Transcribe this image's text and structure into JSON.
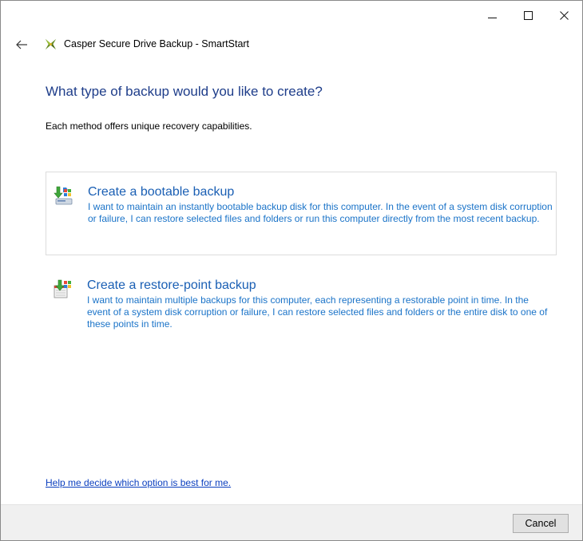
{
  "window": {
    "controls": {
      "minimize": "minimize-icon",
      "maximize": "maximize-icon",
      "close": "close-icon"
    }
  },
  "header": {
    "title": "Casper Secure Drive Backup - SmartStart"
  },
  "main": {
    "heading": "What type of backup would you like to create?",
    "subtitle": "Each method offers unique recovery capabilities.",
    "options": [
      {
        "title": "Create a bootable backup",
        "description": "I want to maintain an instantly bootable backup disk for this computer. In the event of a system disk corruption or failure, I can restore selected files and folders or run this computer directly from the most recent backup."
      },
      {
        "title": "Create a restore-point backup",
        "description": "I want to maintain multiple backups for this computer, each representing a restorable point in time. In the event of a system disk corruption or failure, I can restore selected files and folders or the entire disk to one of these points in time."
      }
    ],
    "help_link": "Help me decide which option is best for me."
  },
  "footer": {
    "cancel_label": "Cancel"
  },
  "colors": {
    "heading": "#1e3d8a",
    "option_title": "#1a5fb4",
    "option_text": "#1a73c8",
    "link": "#0b3fbf",
    "footer_bg": "#f0f0f0"
  }
}
